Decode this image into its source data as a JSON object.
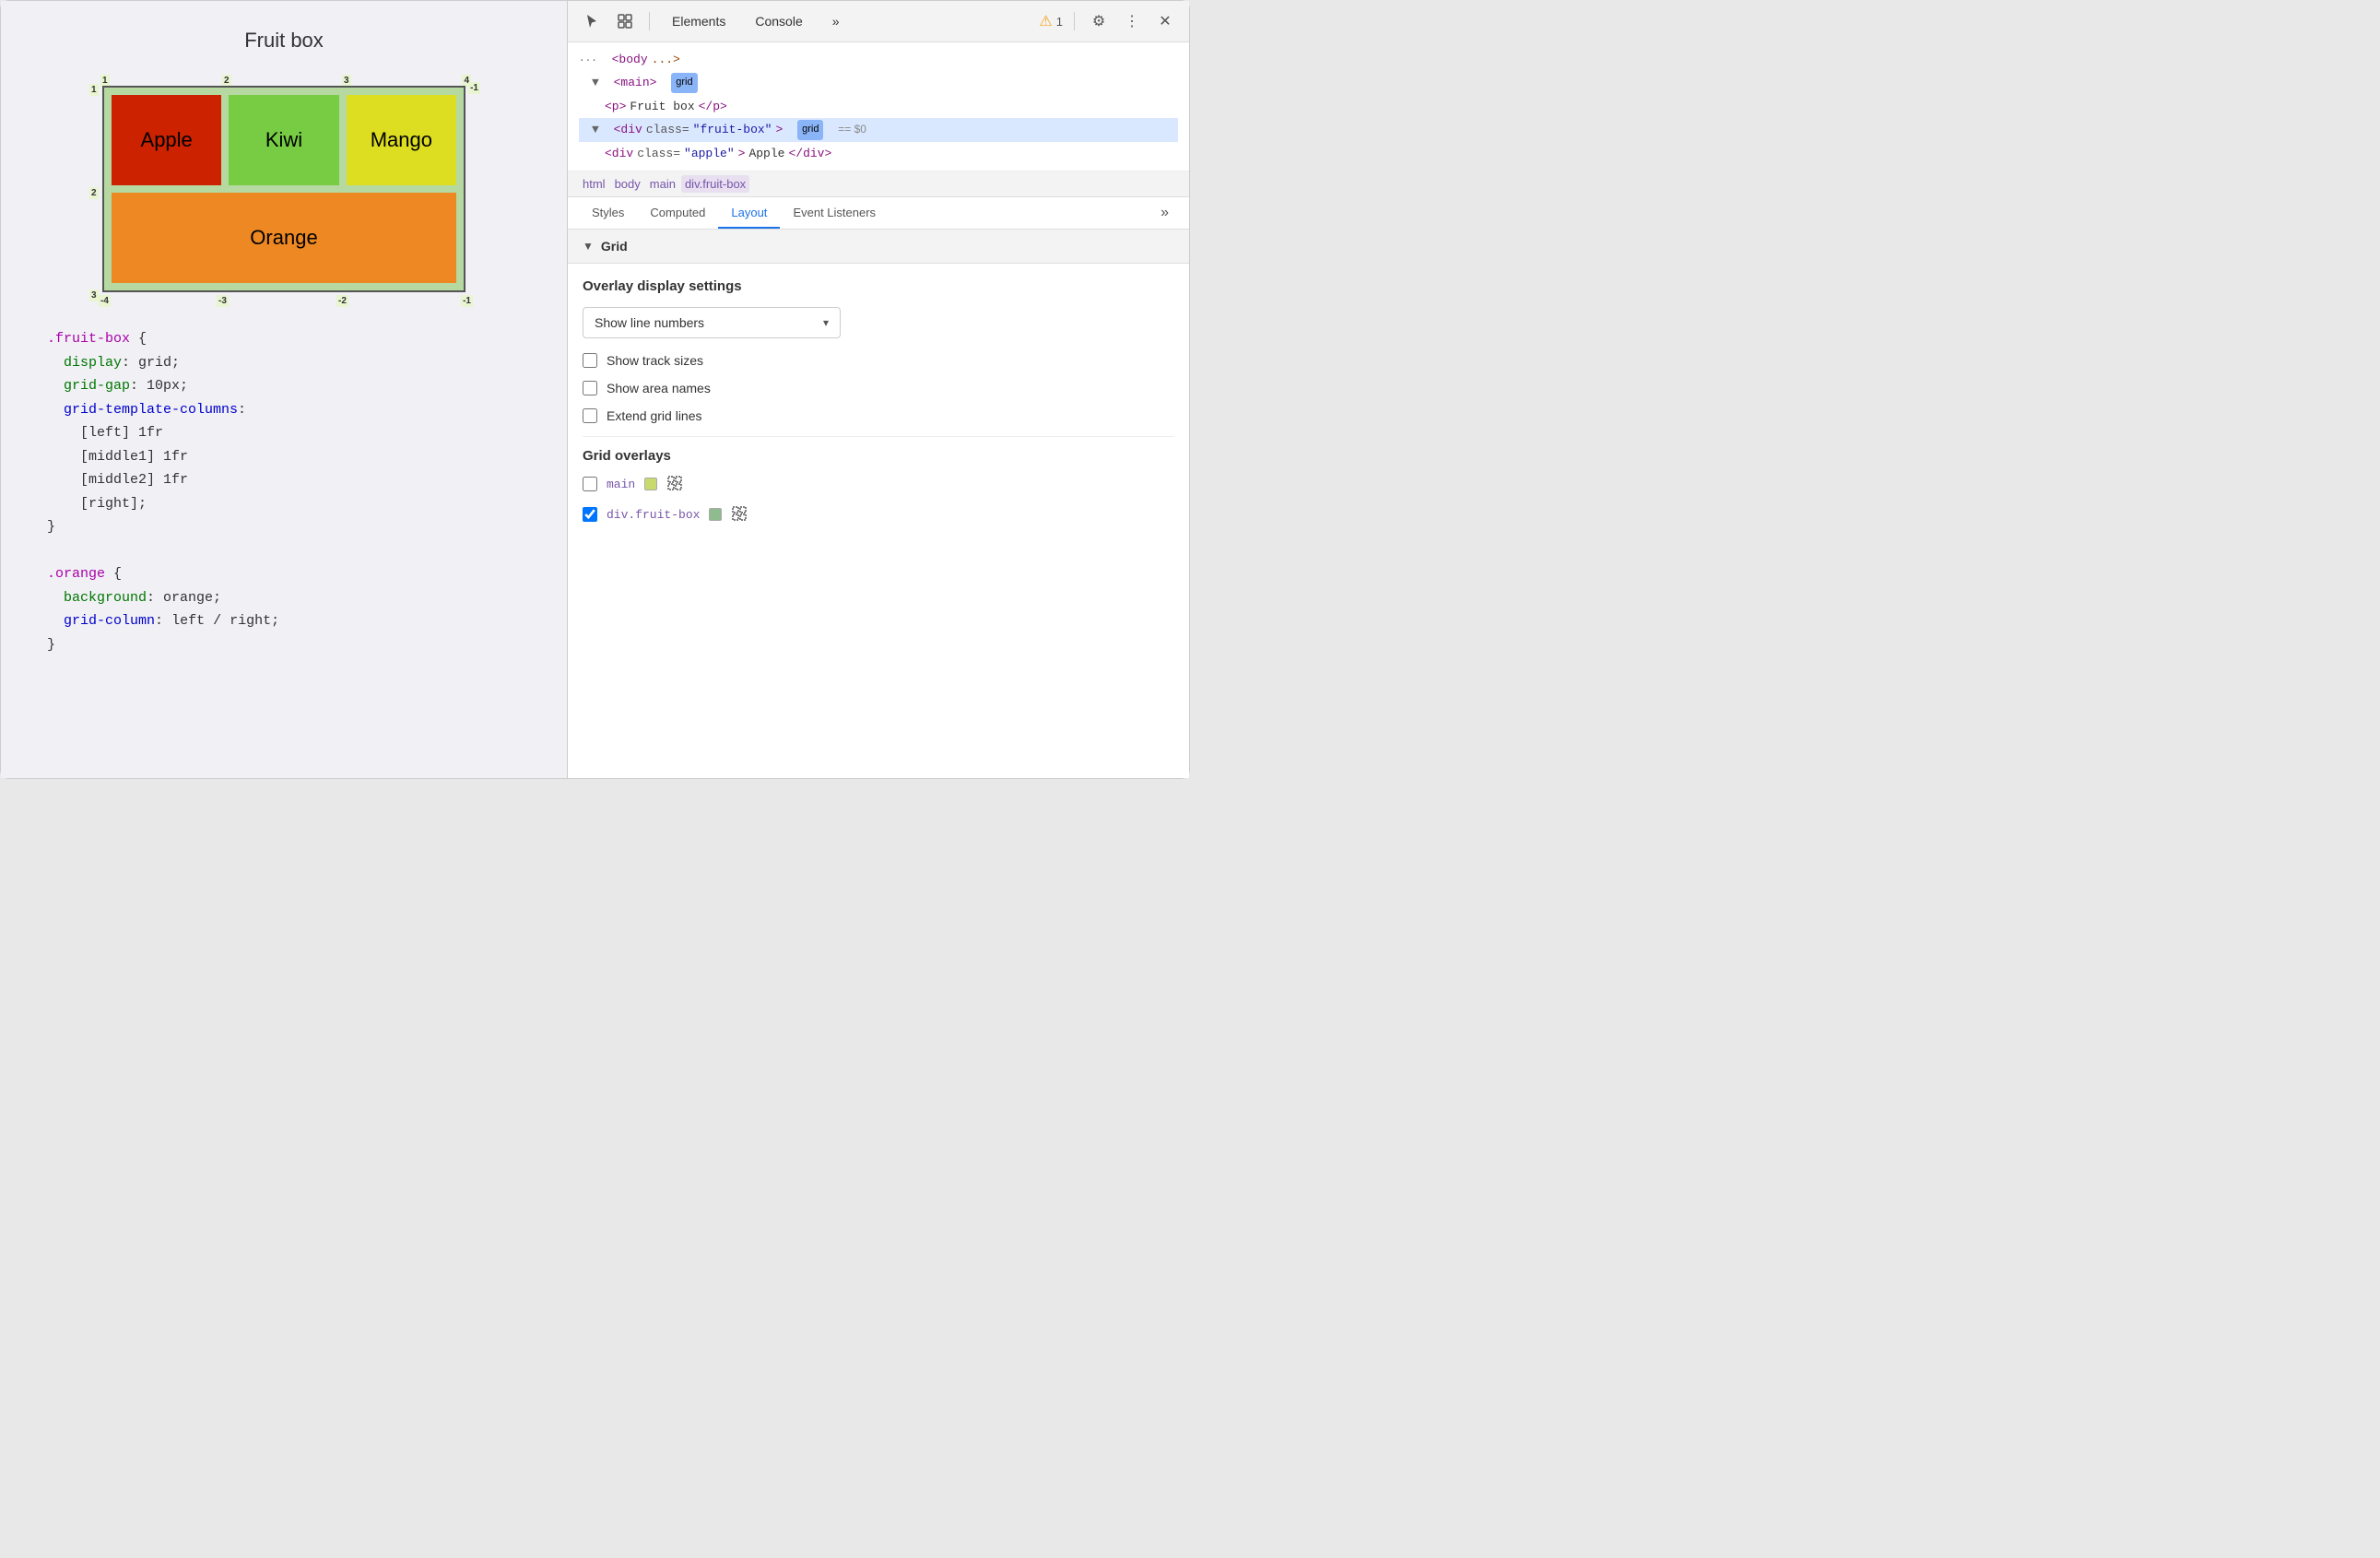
{
  "left": {
    "title": "Fruit box",
    "cells": {
      "apple": "Apple",
      "kiwi": "Kiwi",
      "mango": "Mango",
      "orange": "Orange"
    },
    "grid_numbers": {
      "top": [
        "1",
        "2",
        "3",
        "4"
      ],
      "left": [
        "1",
        "2",
        "3"
      ],
      "bottom_neg": [
        "-4",
        "-3",
        "-2",
        "-1"
      ],
      "right_neg": [
        "-1"
      ]
    },
    "code_block1": [
      ".fruit-box {",
      "  display: grid;",
      "  grid-gap: 10px;",
      "  grid-template-columns:",
      "    [left] 1fr",
      "    [middle1] 1fr",
      "    [middle2] 1fr",
      "    [right];",
      "}"
    ],
    "code_block2": [
      ".orange {",
      "  background: orange;",
      "  grid-column: left / right;",
      "}"
    ]
  },
  "devtools": {
    "toolbar": {
      "tabs": [
        "Elements",
        "Console"
      ],
      "more_label": "»",
      "warning_count": "1",
      "gear_label": "⚙",
      "more_vert_label": "⋮",
      "close_label": "✕"
    },
    "dom_tree": {
      "lines": [
        {
          "indent": 0,
          "content": "<body ...>"
        },
        {
          "indent": 1,
          "content": "▼ <main>",
          "badge": "grid"
        },
        {
          "indent": 2,
          "content": "<p>Fruit box</p>"
        },
        {
          "indent": 1,
          "content": "▼ <div class=\"fruit-box\">",
          "badge": "grid",
          "dollar": "== $0",
          "highlighted": true
        },
        {
          "indent": 2,
          "content": "<div class=\"apple\">Apple</div>"
        }
      ]
    },
    "breadcrumb": {
      "items": [
        "html",
        "body",
        "main",
        "div.fruit-box"
      ]
    },
    "tabs": {
      "items": [
        "Styles",
        "Computed",
        "Layout",
        "Event Listeners"
      ],
      "active": "Layout",
      "more": "»"
    },
    "layout": {
      "grid_section_label": "Grid",
      "overlay_settings_title": "Overlay display settings",
      "dropdown_label": "Show line numbers",
      "checkbox1_label": "Show track sizes",
      "checkbox1_checked": false,
      "checkbox2_label": "Show area names",
      "checkbox2_checked": false,
      "checkbox3_label": "Extend grid lines",
      "checkbox3_checked": false,
      "grid_overlays_title": "Grid overlays",
      "overlays": [
        {
          "checked": false,
          "name": "main",
          "color": "#c8d96e",
          "has_icon": true
        },
        {
          "checked": true,
          "name": "div.fruit-box",
          "color": "#8fbc8f",
          "has_icon": true
        }
      ]
    }
  }
}
